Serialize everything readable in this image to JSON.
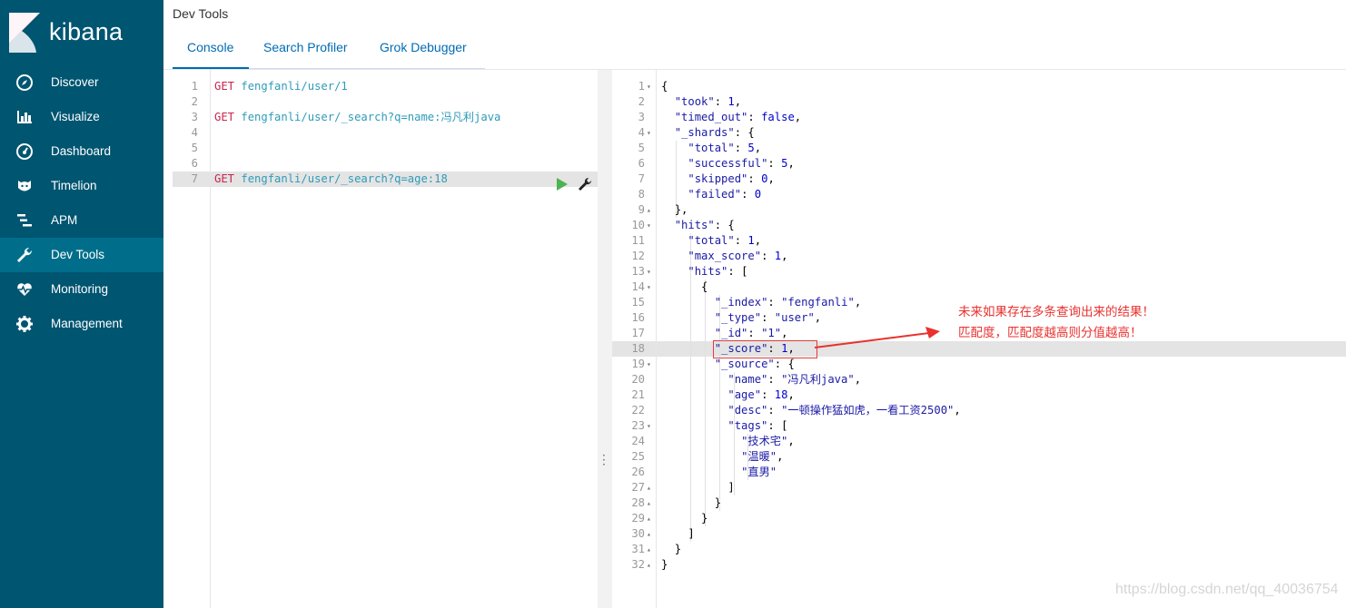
{
  "sidebar": {
    "brand": "kibana",
    "items": [
      {
        "label": "Discover",
        "icon": "compass-icon"
      },
      {
        "label": "Visualize",
        "icon": "bar-chart-icon"
      },
      {
        "label": "Dashboard",
        "icon": "dashboard-icon"
      },
      {
        "label": "Timelion",
        "icon": "timelion-icon"
      },
      {
        "label": "APM",
        "icon": "apm-icon"
      },
      {
        "label": "Dev Tools",
        "icon": "wrench-icon",
        "active": true
      },
      {
        "label": "Monitoring",
        "icon": "heartbeat-icon"
      },
      {
        "label": "Management",
        "icon": "gear-icon"
      }
    ]
  },
  "header": {
    "title": "Dev Tools",
    "tabs": [
      {
        "label": "Console",
        "active": true
      },
      {
        "label": "Search Profiler"
      },
      {
        "label": "Grok Debugger"
      }
    ]
  },
  "request_editor": {
    "lines": [
      {
        "n": "1",
        "method": "GET",
        "path": "fengfanli/user/1"
      },
      {
        "n": "2",
        "method": "",
        "path": ""
      },
      {
        "n": "3",
        "method": "GET",
        "path": "fengfanli/user/_search?q=name:冯凡利java"
      },
      {
        "n": "4",
        "method": "",
        "path": ""
      },
      {
        "n": "5",
        "method": "",
        "path": ""
      },
      {
        "n": "6",
        "method": "",
        "path": ""
      },
      {
        "n": "7",
        "method": "GET",
        "path": "fengfanli/user/_search?q=age:18"
      }
    ]
  },
  "response_editor": {
    "line_numbers": [
      "1",
      "2",
      "3",
      "4",
      "5",
      "6",
      "7",
      "8",
      "9",
      "10",
      "11",
      "12",
      "13",
      "14",
      "15",
      "16",
      "17",
      "18",
      "19",
      "20",
      "21",
      "22",
      "23",
      "24",
      "25",
      "26",
      "27",
      "28",
      "29",
      "30",
      "31",
      "32"
    ],
    "lines": [
      "{",
      "  \"took\": 1,",
      "  \"timed_out\": false,",
      "  \"_shards\": {",
      "    \"total\": 5,",
      "    \"successful\": 5,",
      "    \"skipped\": 0,",
      "    \"failed\": 0",
      "  },",
      "  \"hits\": {",
      "    \"total\": 1,",
      "    \"max_score\": 1,",
      "    \"hits\": [",
      "      {",
      "        \"_index\": \"fengfanli\",",
      "        \"_type\": \"user\",",
      "        \"_id\": \"1\",",
      "        \"_score\": 1,",
      "        \"_source\": {",
      "          \"name\": \"冯凡利java\",",
      "          \"age\": 18,",
      "          \"desc\": \"一顿操作猛如虎，一看工资2500\",",
      "          \"tags\": [",
      "            \"技术宅\",",
      "            \"温暖\",",
      "            \"直男\"",
      "          ]",
      "        }",
      "      }",
      "    ]",
      "  }",
      "}"
    ]
  },
  "annotation": {
    "line1": "未来如果存在多条查询出来的结果！",
    "line2": "匹配度，匹配度越高则分值越高！"
  },
  "watermark": "https://blog.csdn.net/qq_40036754",
  "colors": {
    "sidebar_bg": "#005571",
    "sidebar_active": "#006e8a",
    "tab_link": "#006bb4",
    "annotation_red": "#e8322f"
  }
}
